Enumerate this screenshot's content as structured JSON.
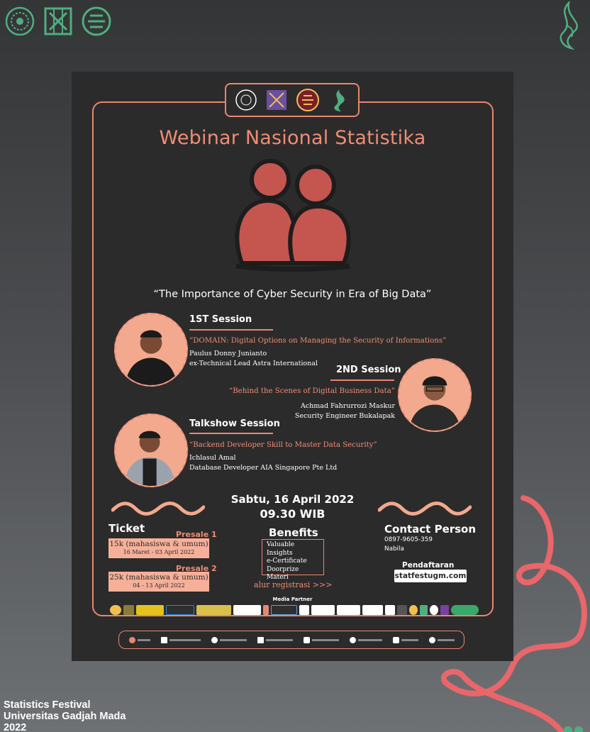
{
  "poster": {
    "title": "Webinar Nasional Statistika",
    "subtitle": "“The Importance of Cyber Security in Era of Big Data”",
    "sessions": [
      {
        "heading": "1ST Session",
        "topic": "“DOMAIN: Digital Options on Managing the Security of Informations”",
        "speaker": "Paulus Donny Junianto",
        "role": "ex-Technical Lead Astra International"
      },
      {
        "heading": "2ND Session",
        "topic": "“Behind the Scenes of Digital Business Data”",
        "speaker": "Achmad Fahrurrozi Maskur",
        "role": "Security Engineer Bukalapak"
      },
      {
        "heading": "Talkshow Session",
        "topic": "“Backend Developer Skill to Master Data Security”",
        "speaker": "Ichlasul Amal",
        "role": "Database Developer AIA Singapore Pte Ltd"
      }
    ],
    "event_date": "Sabtu, 16 April 2022",
    "event_time": "09.30 WIB",
    "ticket": {
      "label": "Ticket",
      "presales": [
        {
          "label": "Presale 1",
          "price": "15k (mahasiswa & umum)",
          "dates": "16 Maret - 03 April 2022"
        },
        {
          "label": "Presale 2",
          "price": "25k (mahasiswa & umum)",
          "dates": "04 - 13 April 2022"
        }
      ]
    },
    "benefits": {
      "label": "Benefits",
      "items": [
        "Valuable Insights",
        "e-Certificate",
        "Doorprize",
        "Materi"
      ]
    },
    "registration_flow": "alur registrasi >>>",
    "contact": {
      "label": "Contact Person",
      "phone": "0897-9605-359",
      "name": "Nabila"
    },
    "registration": {
      "label": "Pendaftaran",
      "site": "statfestugm.com"
    },
    "media_partner_label": "Media Partner"
  },
  "caption": {
    "line1": "Statistics Festival",
    "line2": "Universitas Gadjah Mada",
    "line3": "2022"
  },
  "colors": {
    "accent": "#ed8d75",
    "poster_bg": "#2c2b2b",
    "brand_green": "#4fae80"
  },
  "icons": [
    "ugm-seal-icon",
    "department-logo-icon",
    "statfest-leaf-icon",
    "people-hero-icon",
    "wave-icon"
  ]
}
